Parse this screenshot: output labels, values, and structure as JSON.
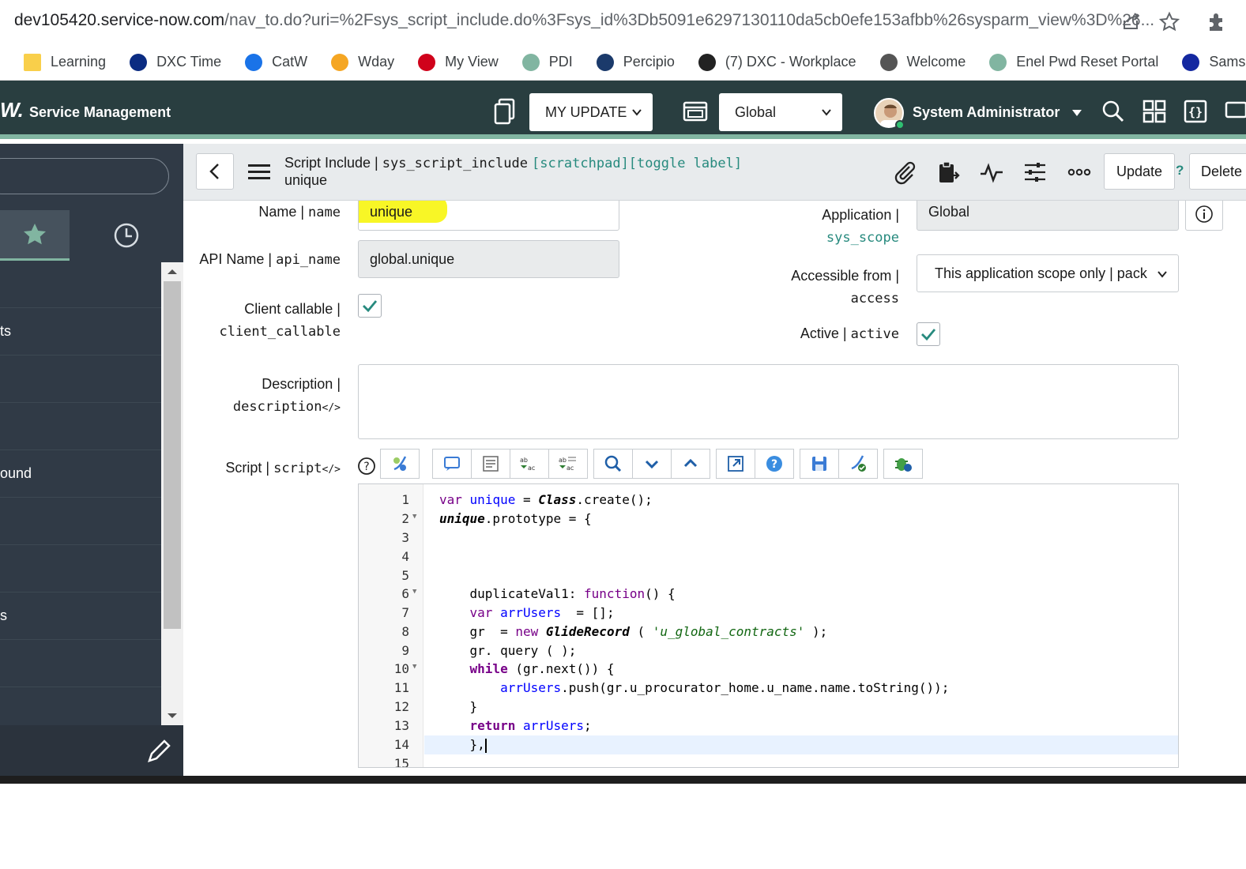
{
  "browser": {
    "url_host": "dev105420.service-now.com",
    "url_path": "/nav_to.do?uri=%2Fsys_script_include.do%3Fsys_id%3Db5091e6297130110da5cb0efe153afbb%26sysparm_view%3D%26..."
  },
  "bookmarks": [
    {
      "label": "Learning",
      "icon": "folder-icon",
      "color": "#f9cf4a"
    },
    {
      "label": "DXC Time",
      "icon": "dxc-icon",
      "color": "#0b2c82"
    },
    {
      "label": "CatW",
      "icon": "sap-icon",
      "color": "#1a73e8"
    },
    {
      "label": "Wday",
      "icon": "workday-icon",
      "color": "#f5a623"
    },
    {
      "label": "My View",
      "icon": "adp-icon",
      "color": "#d0021b"
    },
    {
      "label": "PDI",
      "icon": "servicenow-icon",
      "color": "#81b5a1"
    },
    {
      "label": "Percipio",
      "icon": "percipio-icon",
      "color": "#1b3a6b"
    },
    {
      "label": "(7) DXC - Workplace",
      "icon": "workplace-icon",
      "color": "#222"
    },
    {
      "label": "Welcome",
      "icon": "globe-icon",
      "color": "#555"
    },
    {
      "label": "Enel Pwd Reset Portal",
      "icon": "servicenow-icon",
      "color": "#81b5a1"
    },
    {
      "label": "Samsung Sma",
      "icon": "samsung-icon",
      "color": "#1428a0"
    }
  ],
  "header": {
    "logo": "W.",
    "title": "Service Management",
    "update_set": "MY UPDATE",
    "scope": "Global",
    "user": "System Administrator"
  },
  "leftnav": {
    "rows": [
      "",
      "ts",
      "",
      "",
      "ound",
      "",
      "",
      "s",
      "",
      ""
    ]
  },
  "form_header": {
    "title_main": "Script Include | ",
    "title_table": "sys_script_include",
    "title_links": "[scratchpad][toggle label]",
    "subtitle": "unique",
    "update_label": "Update",
    "help": "?",
    "delete_label": "Delete"
  },
  "form": {
    "name_label": "Name | ",
    "name_code": "name",
    "name_value": "unique",
    "api_label": "API Name | ",
    "api_code": "api_name",
    "api_value": "global.unique",
    "client_label": "Client callable |",
    "client_code": "client_callable",
    "client_checked": true,
    "desc_label": "Description |",
    "desc_code": "description",
    "desc_tag": "</>",
    "desc_value": "",
    "script_label": "Script | ",
    "script_code": "script",
    "script_tag": "</>",
    "app_label": "Application |",
    "app_code": "sys_scope",
    "app_value": "Global",
    "access_label": "Accessible from |",
    "access_code": "access",
    "access_value": "This application scope only | pack",
    "active_label": "Active | ",
    "active_code": "active",
    "active_checked": true
  },
  "editor": {
    "lines": [
      {
        "n": "1",
        "fold": false
      },
      {
        "n": "2",
        "fold": true
      },
      {
        "n": "3",
        "fold": false
      },
      {
        "n": "4",
        "fold": false
      },
      {
        "n": "5",
        "fold": false
      },
      {
        "n": "6",
        "fold": true
      },
      {
        "n": "7",
        "fold": false
      },
      {
        "n": "8",
        "fold": false
      },
      {
        "n": "9",
        "fold": false
      },
      {
        "n": "10",
        "fold": true
      },
      {
        "n": "11",
        "fold": false
      },
      {
        "n": "12",
        "fold": false
      },
      {
        "n": "13",
        "fold": false
      },
      {
        "n": "14",
        "fold": false
      },
      {
        "n": "15",
        "fold": false
      }
    ],
    "code": {
      "l1a": "var",
      "l1b": "unique",
      "l1c": " = ",
      "l1d": "Class",
      "l1e": ".create();",
      "l2a": "unique",
      "l2b": ".prototype = {",
      "l6a": "    duplicateVal1: ",
      "l6b": "function",
      "l6c": "() {",
      "l7a": "    ",
      "l7b": "var",
      "l7c": " ",
      "l7d": "arrUsers",
      "l7e": "  = [];",
      "l8a": "    gr  = ",
      "l8b": "new",
      "l8c": " ",
      "l8d": "GlideRecord",
      "l8e": " ( ",
      "l8f": "'u_global_contracts'",
      "l8g": " );",
      "l9a": "    gr. query ( );",
      "l10a": "    ",
      "l10b": "while",
      "l10c": " (gr.next()) {",
      "l11a": "        ",
      "l11b": "arrUsers",
      "l11c": ".push(gr.u_procurator_home.u_name.name.toString());",
      "l12a": "    }",
      "l13a": "    ",
      "l13b": "return",
      "l13c": " ",
      "l13d": "arrUsers",
      "l13e": ";",
      "l14a": "    },"
    }
  },
  "colors": {
    "header_bg": "#293e40",
    "accent": "#81b5a1",
    "nav_bg": "#303a46",
    "highlight": "#f8f51a",
    "teal_text": "#278a7e"
  }
}
